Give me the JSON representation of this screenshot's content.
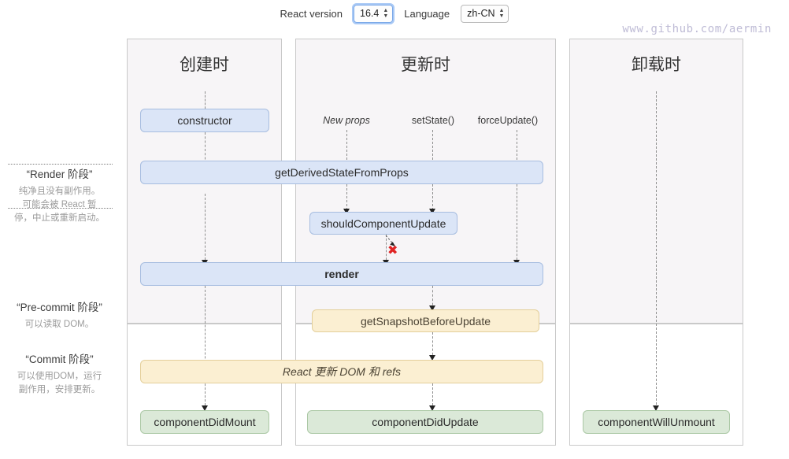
{
  "controls": {
    "react_version_label": "React version",
    "react_version_value": "16.4",
    "language_label": "Language",
    "language_value": "zh-CN"
  },
  "watermark": "www.github.com/aermin",
  "phases": [
    {
      "title": "“Render 阶段”",
      "desc_lines": [
        "纯净且没有副作用。",
        "可能会被 React 暂",
        "停，中止或重新启动。"
      ]
    },
    {
      "title": "“Pre-commit 阶段”",
      "desc_lines": [
        "可以读取 DOM。"
      ]
    },
    {
      "title": "“Commit 阶段”",
      "desc_lines": [
        "可以使用DOM，运行",
        "副作用，安排更新。"
      ]
    }
  ],
  "columns": [
    {
      "key": "mount",
      "title": "创建时"
    },
    {
      "key": "update",
      "title": "更新时"
    },
    {
      "key": "unmount",
      "title": "卸载时"
    }
  ],
  "triggers": [
    {
      "key": "new_props",
      "label": "New props"
    },
    {
      "key": "set_state",
      "label": "setState()"
    },
    {
      "key": "force_update",
      "label": "forceUpdate()"
    }
  ],
  "nodes": {
    "constructor": "constructor",
    "get_derived_state": "getDerivedStateFromProps",
    "should_component_update": "shouldComponentUpdate",
    "render": "render",
    "get_snapshot": "getSnapshotBeforeUpdate",
    "react_updates_dom": "React 更新 DOM 和 refs",
    "component_did_mount": "componentDidMount",
    "component_did_update": "componentDidUpdate",
    "component_will_unmount": "componentWillUnmount"
  },
  "annotations": {
    "skip_update_x": "✖"
  },
  "colors": {
    "blue_fill": "#dbe5f7",
    "blue_border": "#a7bde0",
    "yellow_fill": "#fbefd2",
    "yellow_border": "#e4cf9a",
    "green_fill": "#dbe9d8",
    "green_border": "#abc8a5",
    "panel_top_fill": "#f7f5f7",
    "panel_border": "#c9c9c9",
    "x_mark": "#e02424",
    "watermark": "#bfbcd6"
  }
}
